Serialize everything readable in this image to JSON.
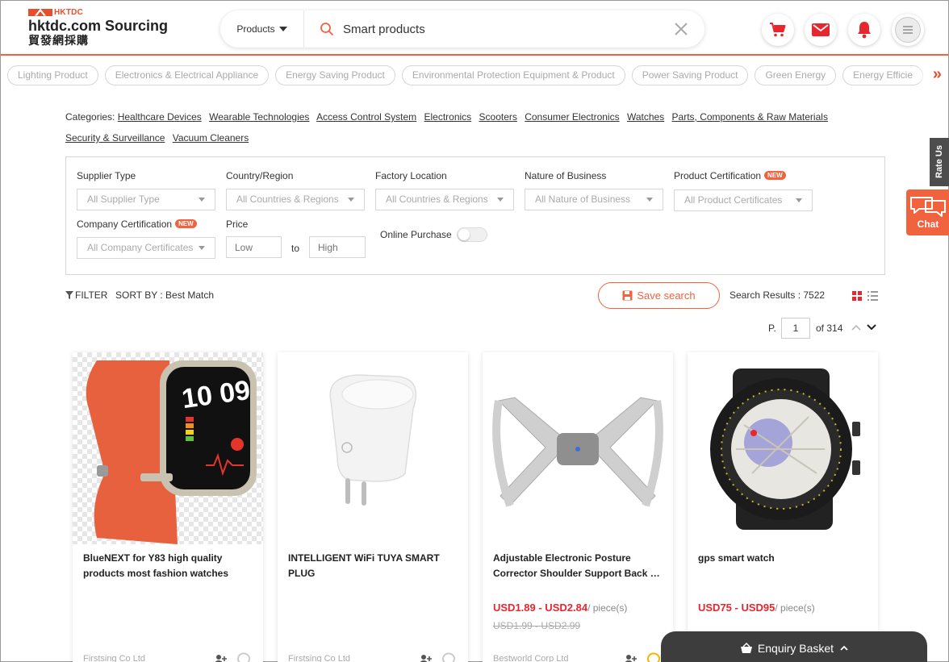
{
  "logo": {
    "brand": "HKTDC",
    "title": "hktdc.com Sourcing",
    "subtitle": "貿發網採購"
  },
  "search": {
    "category": "Products",
    "query": "Smart products"
  },
  "header_icons": [
    "cart-icon",
    "mail-icon",
    "bell-icon",
    "menu-icon"
  ],
  "tags": [
    "Lighting Product",
    "Electronics & Electrical Appliance",
    "Energy Saving Product",
    "Environmental Protection Equipment & Product",
    "Power Saving Product",
    "Green Energy",
    "Energy Efficie"
  ],
  "categories": {
    "label": "Categories:",
    "items": [
      "Healthcare Devices",
      "Wearable Technologies",
      "Access Control System",
      "Electronics",
      "Scooters",
      "Consumer Electronics",
      "Watches",
      "Parts, Components & Raw Materials",
      "Security & Surveillance",
      "Vacuum Cleaners"
    ]
  },
  "filters": {
    "supplier_type": {
      "label": "Supplier Type",
      "value": "All Supplier Type"
    },
    "country_region": {
      "label": "Country/Region",
      "value": "All Countries & Regions"
    },
    "factory_location": {
      "label": "Factory Location",
      "value": "All Countries & Regions"
    },
    "nature_of_business": {
      "label": "Nature of Business",
      "value": "All Nature of Business"
    },
    "product_certification": {
      "label": "Product Certification",
      "badge": "NEW",
      "value": "All Product Certificates"
    },
    "company_certification": {
      "label": "Company Certification",
      "badge": "NEW",
      "value": "All Company Certificates"
    },
    "price": {
      "label": "Price",
      "low_placeholder": "Low",
      "to": "to",
      "high_placeholder": "High"
    },
    "online_purchase": {
      "label": "Online Purchase",
      "enabled": false
    }
  },
  "toolbar": {
    "filter_label": "FILTER",
    "sort_label": "SORT BY : Best Match",
    "save_search_label": "Save search",
    "results_label": "Search Results : 7522"
  },
  "pager": {
    "p_label": "P.",
    "current": "1",
    "of_label": "of 314"
  },
  "products": [
    {
      "title": "BlueNEXT for Y83 high quality products most fashion watches TFT…",
      "price": "",
      "unit": "",
      "old_price": "",
      "supplier": "Firstsing Co Ltd"
    },
    {
      "title": "INTELLIGENT WiFi TUYA SMART PLUG",
      "price": "",
      "unit": "",
      "old_price": "",
      "supplier": "Firstsing Co Ltd"
    },
    {
      "title": "Adjustable Electronic Posture Corrector Shoulder Support Back …",
      "price": "USD1.89 - USD2.84",
      "unit": "/ piece(s)",
      "old_price": "USD1.99 - USD2.99",
      "supplier": "Bestworld Corp Ltd"
    },
    {
      "title": "gps smart watch",
      "price": "USD75 - USD95",
      "unit": "/ piece(s)",
      "old_price": "",
      "supplier": ""
    }
  ],
  "widgets": {
    "rate_us": "Rate Us",
    "chat": "Chat",
    "basket": "Enquiry Basket"
  },
  "colors": {
    "accent": "#f1623f",
    "price": "#e8262d",
    "basket_bg": "#3d3d3d"
  }
}
